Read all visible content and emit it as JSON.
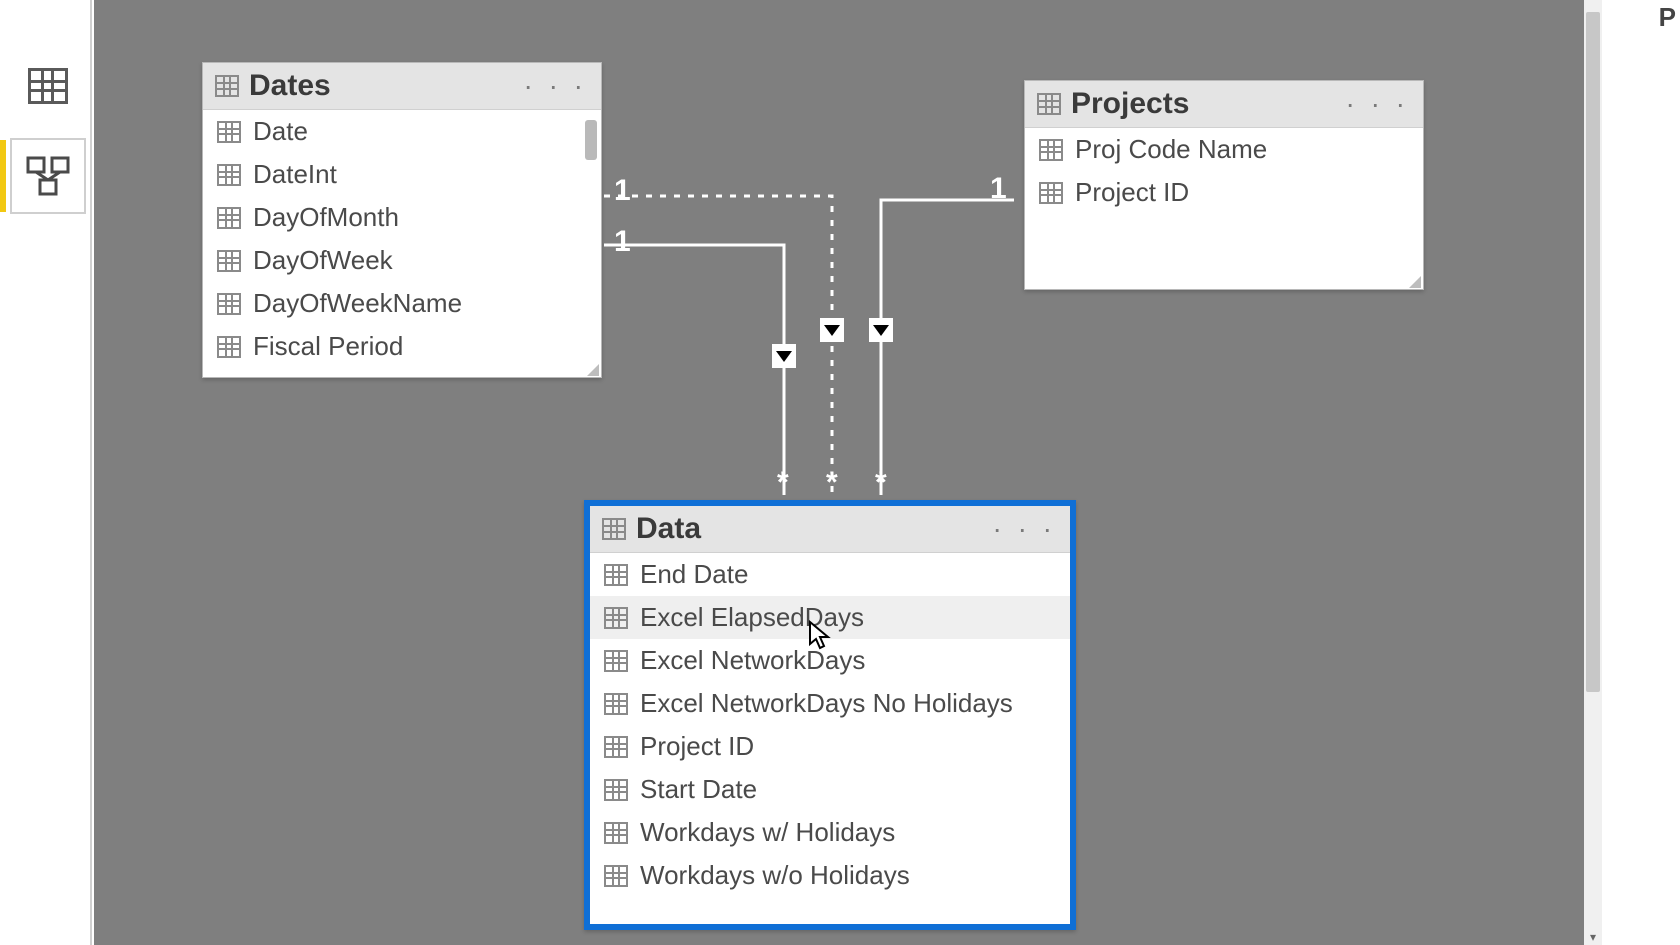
{
  "rail": {
    "data_view": "Data view",
    "model_view": "Model view"
  },
  "tables": {
    "dates": {
      "title": "Dates",
      "fields": [
        "Date",
        "DateInt",
        "DayOfMonth",
        "DayOfWeek",
        "DayOfWeekName",
        "Fiscal Period"
      ]
    },
    "projects": {
      "title": "Projects",
      "fields": [
        "Proj Code Name",
        "Project ID"
      ]
    },
    "data": {
      "title": "Data",
      "fields": [
        "End Date",
        "Excel ElapsedDays",
        "Excel NetworkDays",
        "Excel NetworkDays No Holidays",
        "Project ID",
        "Start Date",
        "Workdays w/ Holidays",
        "Workdays w/o Holidays"
      ]
    }
  },
  "rel": {
    "one": "1",
    "many": "*"
  },
  "right_peek": "P",
  "dots": "· · ·"
}
